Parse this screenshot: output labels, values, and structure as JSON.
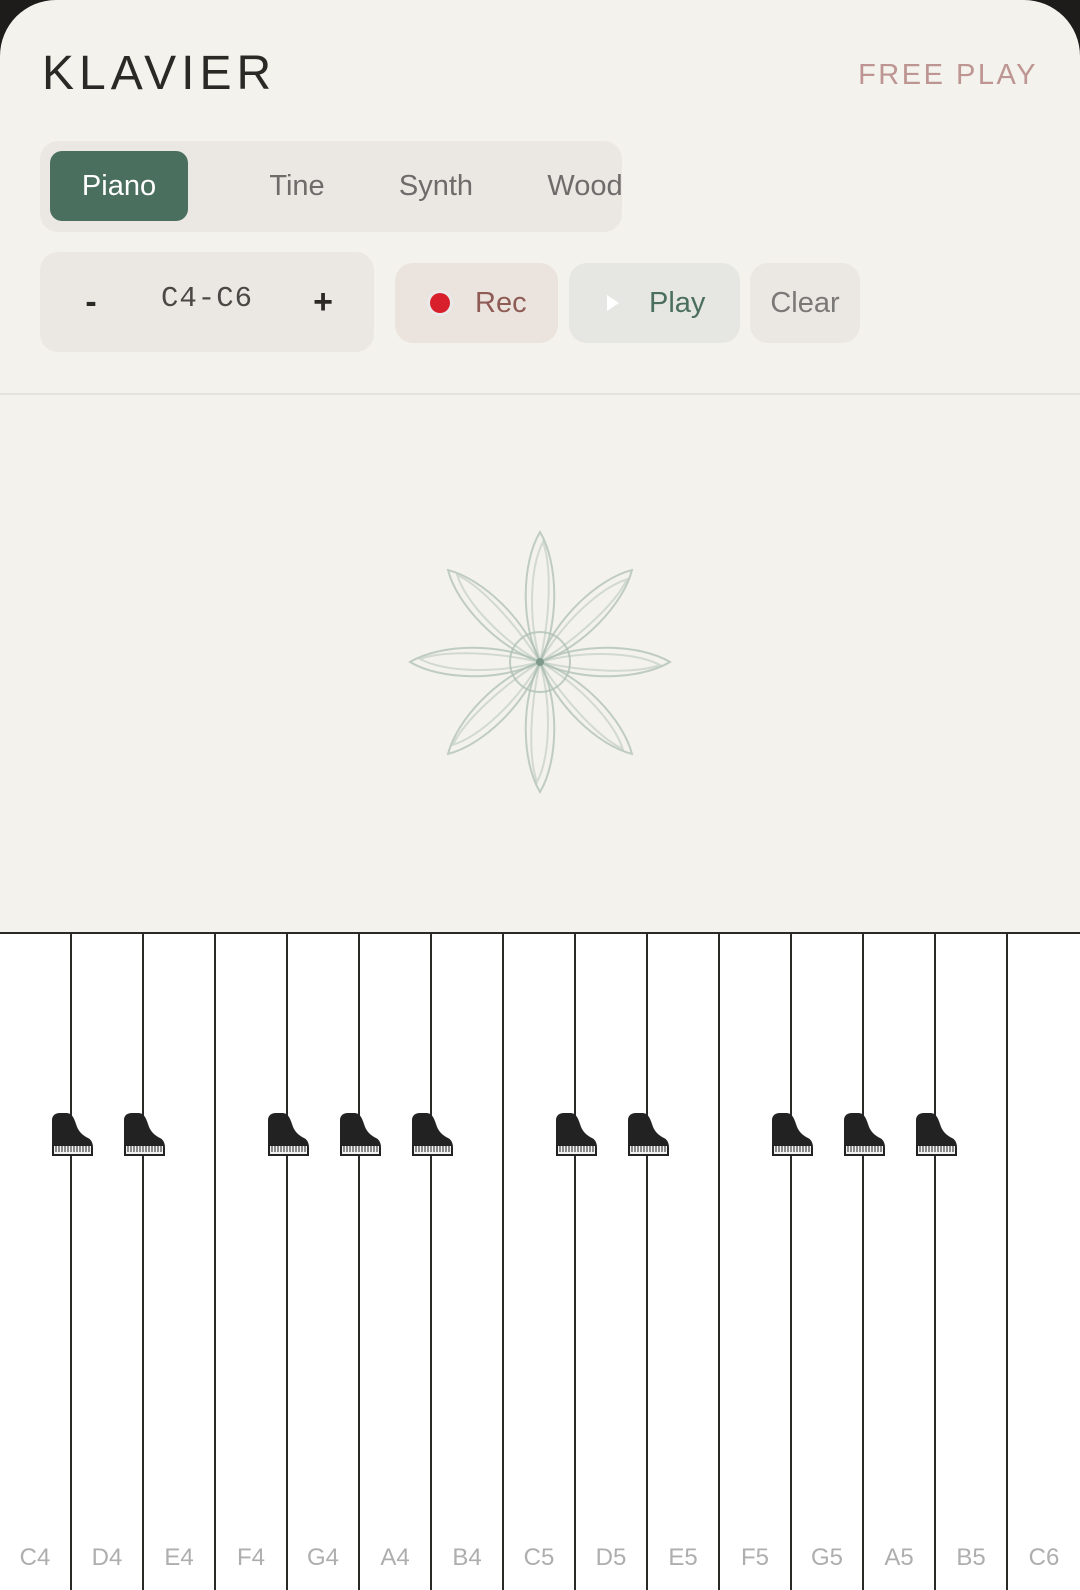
{
  "header": {
    "title": "KLAVIER",
    "mode": "FREE PLAY"
  },
  "instruments": {
    "selected": "Piano",
    "options": [
      "Piano",
      "Tine",
      "Synth",
      "Wood"
    ]
  },
  "range": {
    "decrease": "-",
    "value": "C4-C6",
    "increase": "+"
  },
  "transport": {
    "rec": "Rec",
    "play": "Play",
    "clear": "Clear"
  },
  "colors": {
    "accent": "#4b6f5f",
    "background": "#f4f2ec",
    "rec_red": "#d8202d",
    "mode_text": "#bd9592"
  },
  "keyboard": {
    "white_keys": [
      "C4",
      "D4",
      "E4",
      "F4",
      "G4",
      "A4",
      "B4",
      "C5",
      "D5",
      "E5",
      "F5",
      "G5",
      "A5",
      "B5",
      "C6"
    ],
    "black_key_icon": "grand-piano-icon",
    "black_keys": [
      "C#4",
      "D#4",
      "F#4",
      "G#4",
      "A#4",
      "C#5",
      "D#5",
      "F#5",
      "G#5",
      "A#5"
    ]
  }
}
